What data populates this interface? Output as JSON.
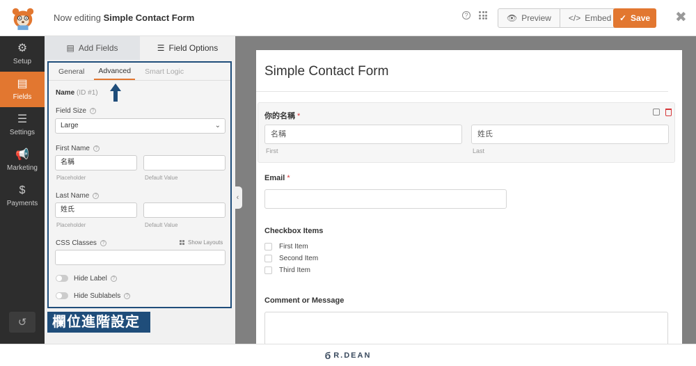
{
  "header": {
    "title_prefix": "Now editing",
    "title_form": "Simple Contact Form",
    "help_glyph": "?",
    "preview_label": "Preview",
    "embed_label": "Embed",
    "save_label": "Save",
    "close_glyph": "✖",
    "accent": "#e27730"
  },
  "leftnav": {
    "items": [
      {
        "label": "Setup",
        "icon": "gear-icon",
        "glyph": "⚙"
      },
      {
        "label": "Fields",
        "icon": "list-icon",
        "glyph": "▤"
      },
      {
        "label": "Settings",
        "icon": "sliders-icon",
        "glyph": "☰"
      },
      {
        "label": "Marketing",
        "icon": "megaphone-icon",
        "glyph": "📢"
      },
      {
        "label": "Payments",
        "icon": "dollar-icon",
        "glyph": "$"
      }
    ],
    "history_glyph": "↺"
  },
  "panel": {
    "tabs": [
      "Add Fields",
      "Field Options"
    ],
    "subtabs": [
      "General",
      "Advanced",
      "Smart Logic"
    ],
    "field_name": "Name",
    "field_id": "(ID #1)",
    "field_size_label": "Field Size",
    "field_size_value": "Large",
    "first_name_label": "First Name",
    "first_name_placeholder": "名稱",
    "last_name_label": "Last Name",
    "last_name_placeholder": "姓氏",
    "placeholder_hint": "Placeholder",
    "default_value_hint": "Default Value",
    "css_classes_label": "CSS Classes",
    "show_layouts_label": "Show Layouts",
    "hide_label": "Hide Label",
    "hide_sublabels": "Hide Sublabels",
    "caption": "欄位進階設定",
    "caption_color": "#1f4d7a"
  },
  "form": {
    "title": "Simple Contact Form",
    "name_label": "你的名稱",
    "first_placeholder": "名稱",
    "last_placeholder": "姓氏",
    "first_sub": "First",
    "last_sub": "Last",
    "required_mark": "*",
    "email_label": "Email",
    "checkbox_label": "Checkbox Items",
    "checkbox_items": [
      "First Item",
      "Second Item",
      "Third Item"
    ],
    "comment_label": "Comment or Message"
  },
  "footer": {
    "brand": "R.DEAN",
    "brand_mark": "б"
  }
}
